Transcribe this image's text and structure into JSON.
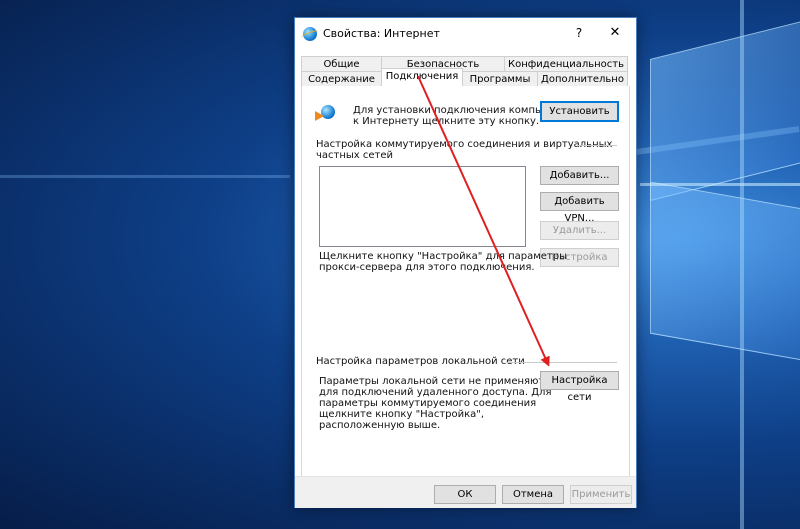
{
  "window": {
    "title": "Свойства: Интернет",
    "help_glyph": "?",
    "close_glyph": "✕"
  },
  "tabs": {
    "row1": [
      "Общие",
      "Безопасность",
      "Конфиденциальность"
    ],
    "row2": [
      "Содержание",
      "Подключения",
      "Программы",
      "Дополнительно"
    ],
    "active": "Подключения"
  },
  "setup": {
    "text_line1": "Для установки подключения компьютера",
    "text_line2": "к Интернету щелкните эту кнопку.",
    "button": "Установить"
  },
  "dialup": {
    "group_line1": "Настройка коммутируемого соединения и виртуальных",
    "group_line2": "частных сетей",
    "buttons": {
      "add": "Добавить...",
      "add_vpn": "Добавить VPN...",
      "remove": "Удалить...",
      "settings": "Настройка"
    },
    "hint_line1": "Щелкните кнопку \"Настройка\" для параметры",
    "hint_line2": "прокси-сервера для этого подключения."
  },
  "lan": {
    "group_label": "Настройка параметров локальной сети",
    "desc_lines": [
      "Параметры локальной сети не применяются",
      "для подключений удаленного доступа. Для",
      "параметры коммутируемого соединения",
      "щелкните кнопку \"Настройка\",",
      "расположенную выше."
    ],
    "button": "Настройка сети"
  },
  "footer": {
    "ok": "ОК",
    "cancel": "Отмена",
    "apply": "Применить"
  },
  "colors": {
    "annotation_arrow": "#e02020",
    "accent": "#0078d7"
  }
}
